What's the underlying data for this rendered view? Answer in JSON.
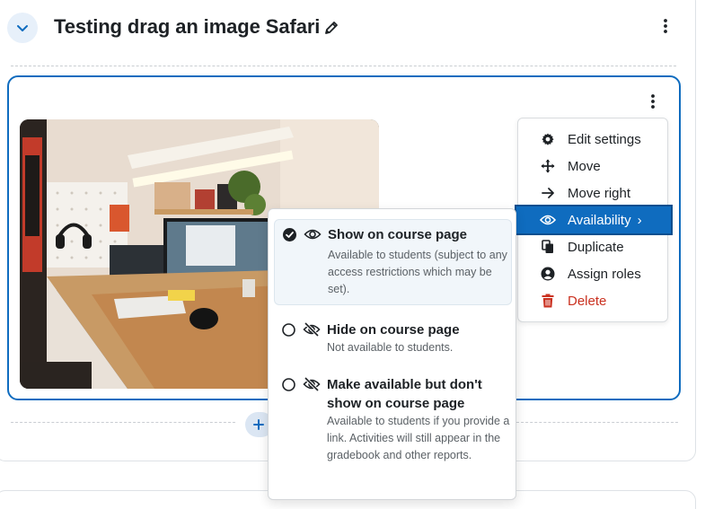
{
  "section": {
    "title": "Testing drag an image Safari",
    "collapse_icon": "chevron-down-icon",
    "edit_icon": "pencil-icon",
    "menu_icon": "kebab-icon"
  },
  "activity": {
    "image_alt": "Desk setup photo",
    "menu_icon": "kebab-icon"
  },
  "action_menu": {
    "items": [
      {
        "label": "Edit settings",
        "icon": "gear-icon"
      },
      {
        "label": "Move",
        "icon": "move-arrows-icon"
      },
      {
        "label": "Move right",
        "icon": "arrow-right-icon"
      },
      {
        "label": "Availability",
        "icon": "eye-icon",
        "suffix": "›",
        "active": true
      },
      {
        "label": "Duplicate",
        "icon": "copy-icon"
      },
      {
        "label": "Assign roles",
        "icon": "user-circle-icon"
      },
      {
        "label": "Delete",
        "icon": "trash-icon",
        "danger": true
      }
    ]
  },
  "availability": {
    "options": [
      {
        "title": "Show on course page",
        "description": "Available to students (subject to any access restrictions which may be set).",
        "icon": "eye-icon",
        "selected": true
      },
      {
        "title": "Hide on course page",
        "description": "Not available to students.",
        "icon": "eye-slash-icon",
        "selected": false
      },
      {
        "title": "Make available but don't show on course page",
        "description": "Available to students if you provide a link. Activities will still appear in the gradebook and other reports.",
        "icon": "eye-slash-icon",
        "selected": false
      }
    ]
  },
  "colors": {
    "accent": "#0f6cbf",
    "danger": "#ca3120"
  }
}
